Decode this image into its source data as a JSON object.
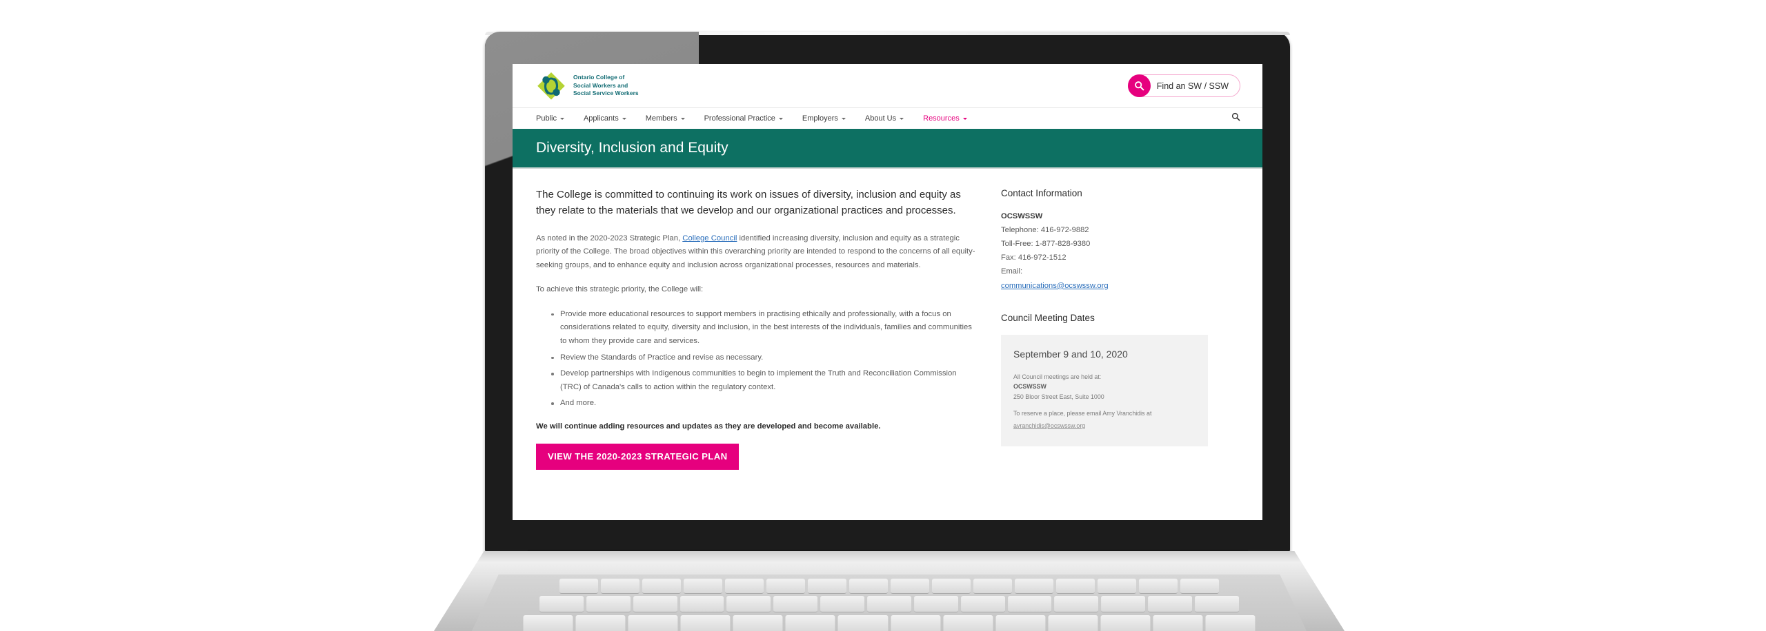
{
  "site": {
    "brand": {
      "line1": "Ontario College of",
      "line2": "Social Workers and",
      "line3": "Social Service Workers",
      "logo_icon": "ocswssw-diamond-logo",
      "color_teal": "#0f6a72",
      "color_green": "#a6ce39"
    },
    "find_button": {
      "label": "Find an SW / SSW",
      "icon": "search-icon",
      "accent": "#e6007e"
    },
    "nav": {
      "items": [
        {
          "label": "Public",
          "has_dropdown": true,
          "active": false
        },
        {
          "label": "Applicants",
          "has_dropdown": true,
          "active": false
        },
        {
          "label": "Members",
          "has_dropdown": true,
          "active": false
        },
        {
          "label": "Professional Practice",
          "has_dropdown": true,
          "active": false
        },
        {
          "label": "Employers",
          "has_dropdown": true,
          "active": false
        },
        {
          "label": "About Us",
          "has_dropdown": true,
          "active": false
        },
        {
          "label": "Resources",
          "has_dropdown": true,
          "active": true
        }
      ],
      "search_icon": "search-icon"
    }
  },
  "banner": {
    "title": "Diversity, Inclusion and Equity",
    "background": "#0d7062"
  },
  "main": {
    "lead": "The College is committed to continuing its work on issues of diversity, inclusion and equity as they relate to the materials that we develop and our organizational practices and processes.",
    "paragraph1_before_link": "As noted in the 2020-2023 Strategic Plan, ",
    "paragraph1_link": "College Council",
    "paragraph1_after_link": " identified increasing diversity, inclusion and equity as a strategic priority of the College. The broad objectives within this overarching priority are intended to respond to the concerns of all equity-seeking groups, and to enhance equity and inclusion across organizational processes, resources and materials.",
    "paragraph2": "To achieve this strategic priority, the College will:",
    "bullets": [
      "Provide more educational resources to support members in practising ethically and professionally, with a focus on considerations related to equity, diversity and inclusion, in the best interests of the individuals, families and communities to whom they provide care and services.",
      "Review the Standards of Practice and revise as necessary.",
      "Develop partnerships with Indigenous communities to begin to implement the Truth and Reconciliation Commission (TRC) of Canada's calls to action within the regulatory context.",
      "And more."
    ],
    "closing": "We will continue adding resources and updates as they are developed and become available.",
    "cta_label": "VIEW THE 2020-2023 STRATEGIC PLAN",
    "cta_color": "#e6007e"
  },
  "sidebar": {
    "contact": {
      "heading": "Contact Information",
      "org": "OCSWSSW",
      "telephone": "Telephone: 416-972-9882",
      "toll_free": "Toll-Free: 1-877-828-9380",
      "fax": "Fax: 416-972-1512",
      "email_label": "Email:",
      "email": "communications@ocswssw.org"
    },
    "council": {
      "heading": "Council Meeting Dates",
      "date": "September 9 and 10, 2020",
      "held_at_label": "All Council meetings are held at:",
      "org": "OCSWSSW",
      "address": "250 Bloor Street East, Suite 1000",
      "reserve_text": "To reserve a place, please email Amy Vranchidis at",
      "reserve_email": "avranchidis@ocswssw.org"
    }
  }
}
